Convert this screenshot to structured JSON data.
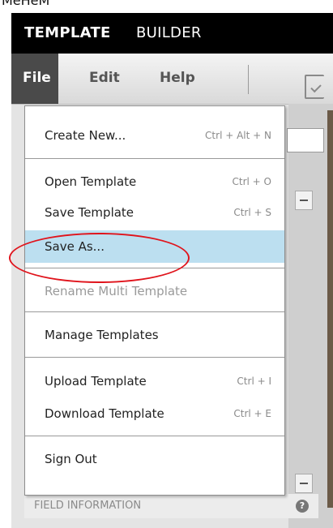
{
  "top_crop_text": "MeHeM",
  "app": {
    "title_bold": "TEMPLATE",
    "title_rest": "BUILDER"
  },
  "menubar": {
    "tabs": [
      "File",
      "Edit",
      "Help"
    ],
    "active_tab": "File",
    "doc_icon": "document-check-icon"
  },
  "file_menu": {
    "items": [
      {
        "label": "Create New...",
        "shortcut": "Ctrl + Alt + N"
      },
      {
        "label": "Open Template",
        "shortcut": "Ctrl + O"
      },
      {
        "label": "Save Template",
        "shortcut": "Ctrl + S"
      },
      {
        "label": "Save As...",
        "shortcut": "",
        "highlighted": true
      },
      {
        "label": "Rename Multi Template",
        "shortcut": "",
        "disabled": true
      },
      {
        "label": "Manage Templates",
        "shortcut": ""
      },
      {
        "label": "Upload Template",
        "shortcut": "Ctrl + I"
      },
      {
        "label": "Download Template",
        "shortcut": "Ctrl + E"
      },
      {
        "label": "Sign Out",
        "shortcut": ""
      }
    ]
  },
  "background_panel": {
    "field_info_label": "FIELD INFORMATION",
    "help_icon_glyph": "?"
  },
  "colors": {
    "title_bar": "#000000",
    "active_tab": "#4a4a4a",
    "highlight": "#bcdff0",
    "annotation": "#e0141c"
  }
}
